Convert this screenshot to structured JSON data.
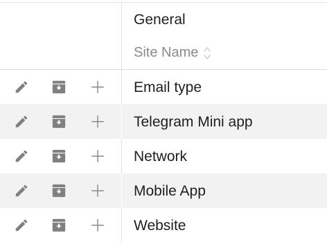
{
  "header": {
    "group_label": "General",
    "column_label": "Site Name"
  },
  "icons": {
    "edit": "pencil-icon",
    "archive": "archive-box-icon",
    "add": "plus-icon",
    "sort": "sort-arrows-icon"
  },
  "colors": {
    "icon": "#808080",
    "row_stripe": "#f2f2f2"
  },
  "rows": [
    {
      "site_name": "Email type"
    },
    {
      "site_name": "Telegram Mini app"
    },
    {
      "site_name": "Network"
    },
    {
      "site_name": "Mobile App"
    },
    {
      "site_name": "Website"
    }
  ]
}
